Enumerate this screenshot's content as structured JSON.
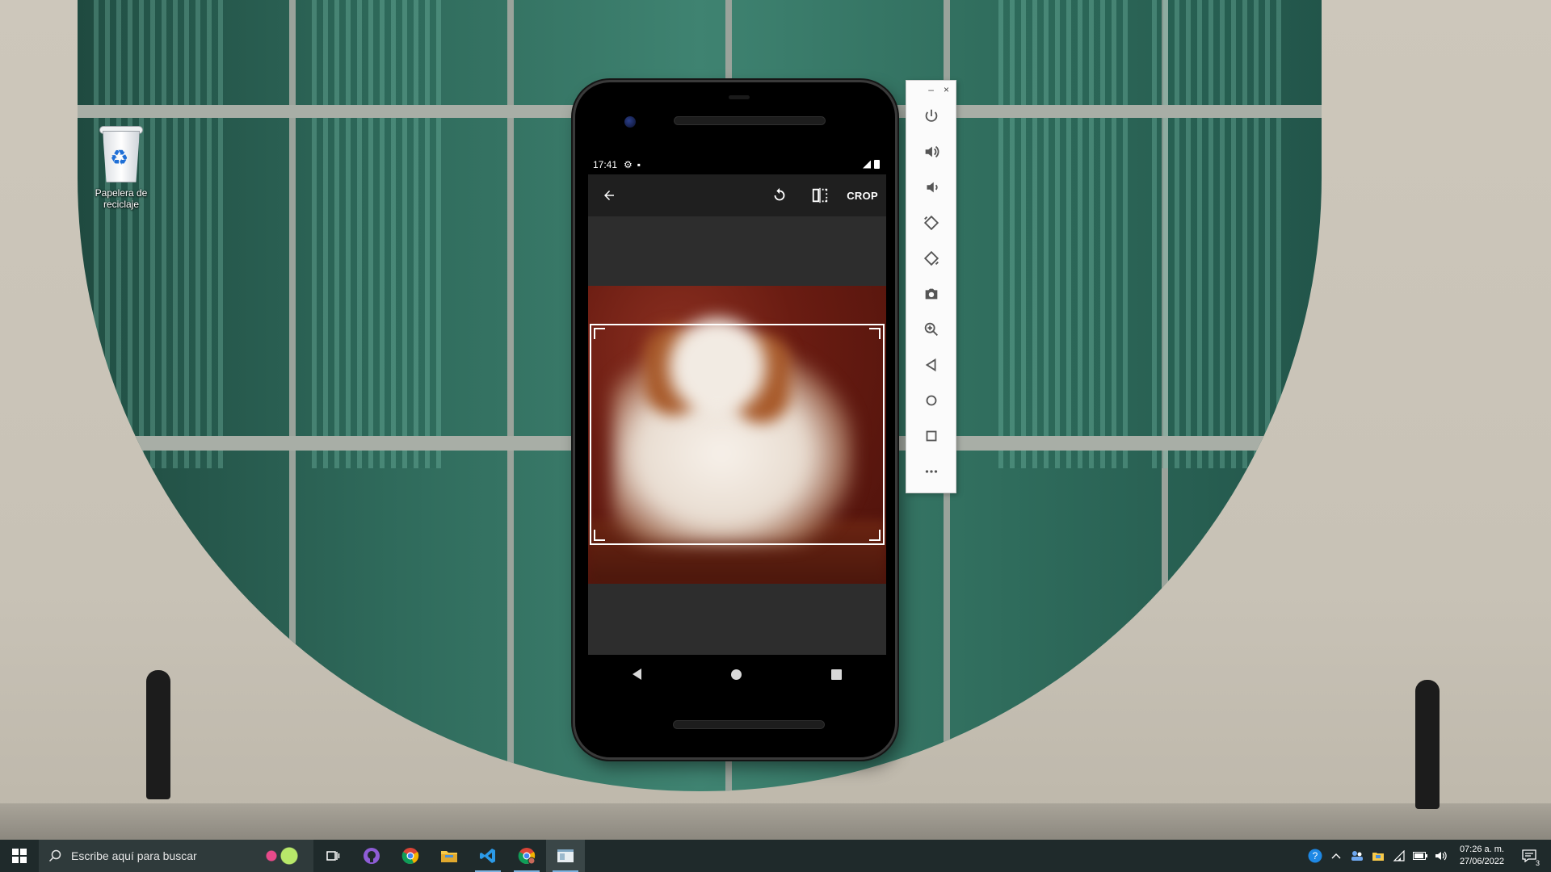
{
  "desktop": {
    "recycle_bin_label": "Papelera de reciclaje"
  },
  "phone": {
    "status": {
      "time": "17:41",
      "icons": [
        "settings-icon",
        "sim-icon"
      ],
      "right_icons": [
        "signal-icon",
        "battery-icon"
      ]
    },
    "toolbar": {
      "back_icon": "arrow-left-icon",
      "rotate_icon": "rotate-icon",
      "flip_icon": "flip-icon",
      "crop_label": "CROP"
    },
    "nav": [
      "back-triangle-icon",
      "home-circle-icon",
      "recents-square-icon"
    ]
  },
  "emulator_panel": {
    "window_controls": {
      "minimize": "–",
      "close": "×"
    },
    "buttons": [
      "power",
      "volume-up",
      "volume-down",
      "rotate-left",
      "rotate-right",
      "screenshot",
      "zoom",
      "back",
      "home",
      "overview",
      "more"
    ]
  },
  "taskbar": {
    "search_placeholder": "Escribe aquí para buscar",
    "apps": [
      "task-view",
      "github-desktop",
      "chrome",
      "file-explorer",
      "vscode",
      "chrome-profile",
      "emulator"
    ],
    "clock": {
      "time": "07:26 a. m.",
      "date": "27/06/2022"
    },
    "notification_count": "3"
  },
  "colors": {
    "taskbar_bg": "#1f2a2b",
    "toolbar_bg": "#1f1f1f",
    "canvas_bg": "#2d2d2d"
  }
}
